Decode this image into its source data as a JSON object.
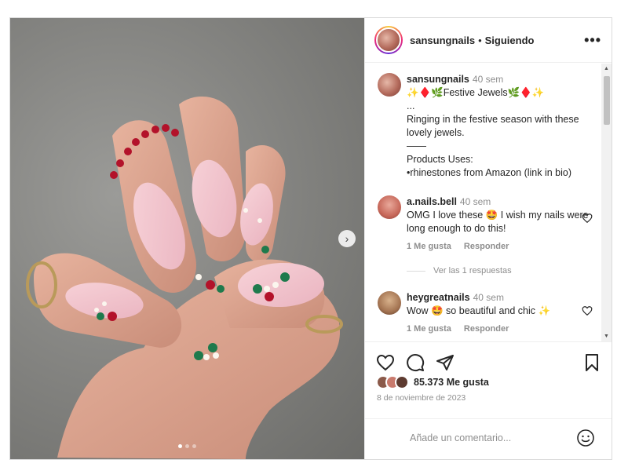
{
  "post": {
    "username": "sansungnails",
    "separator": "•",
    "follow_status": "Siguiendo",
    "more_label": "•••",
    "image_dots": 3,
    "active_dot": 0
  },
  "caption": {
    "username": "sansungnails",
    "time": "40 sem",
    "title_line": "✨♦️🌿Festive Jewels🌿♦️✨",
    "ellipsis": "...",
    "body": "Ringing in the festive season with these lovely jewels.",
    "divider": "——",
    "products_heading": "Products Uses:",
    "products_item": "•rhinestones from Amazon (link in bio)"
  },
  "comments": [
    {
      "username": "a.nails.bell",
      "time": "40 sem",
      "text": "OMG I love these 🤩 I wish my nails were long enough to do this!",
      "likes": "1 Me gusta",
      "reply": "Responder",
      "view_replies": "Ver las 1 respuestas"
    },
    {
      "username": "heygreatnails",
      "time": "40 sem",
      "text": "Wow 🤩 so beautiful and chic ✨",
      "likes": "1 Me gusta",
      "reply": "Responder"
    }
  ],
  "engagement": {
    "likes_count": "85.373 Me gusta",
    "date": "8 de noviembre de 2023"
  },
  "composer": {
    "placeholder": "Añade un comentario..."
  },
  "icons": {
    "like": "heart-icon",
    "comment": "comment-icon",
    "share": "paper-plane-icon",
    "save": "bookmark-icon",
    "emoji": "smiley-icon",
    "next": "chevron-right-icon",
    "more": "more-horizontal-icon"
  },
  "colors": {
    "text": "#262626",
    "muted": "#8e8e8e",
    "border": "#dbdbdb",
    "story_ring": "#ee2a7b"
  }
}
